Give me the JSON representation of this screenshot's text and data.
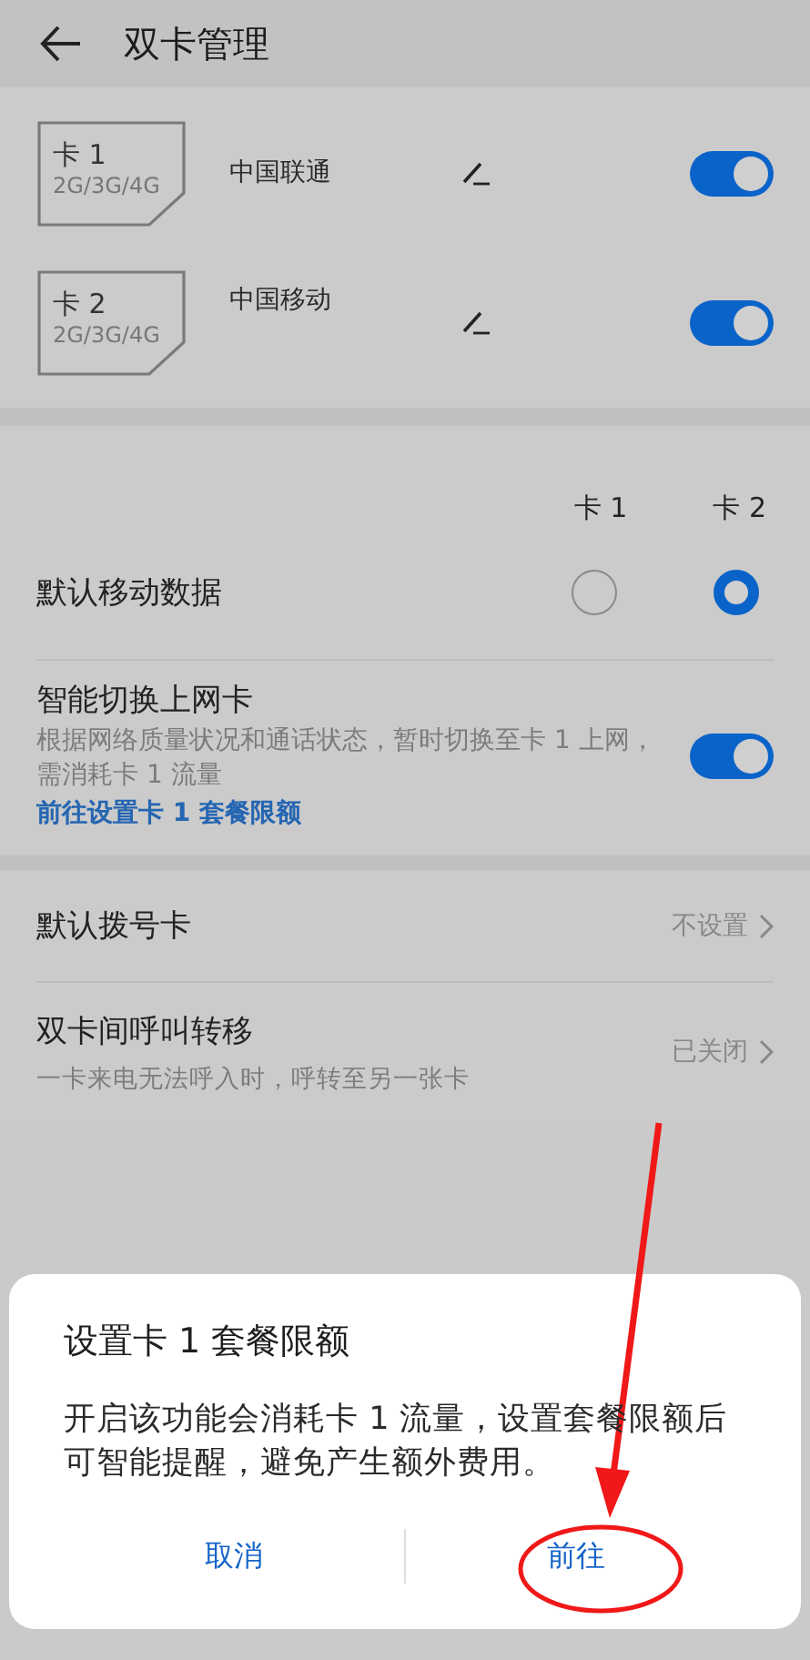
{
  "header": {
    "title": "双卡管理"
  },
  "sims": [
    {
      "label": "卡 1",
      "network": "2G/3G/4G",
      "carrier": "中国联通",
      "on": true
    },
    {
      "label": "卡 2",
      "network": "2G/3G/4G",
      "carrier": "中国移动",
      "on": true
    }
  ],
  "data_section": {
    "columns": [
      "卡 1",
      "卡 2"
    ],
    "default_data": {
      "label": "默认移动数据",
      "options": [
        {
          "selected": false
        },
        {
          "selected": true
        }
      ]
    },
    "smart_switch": {
      "title": "智能切换上网卡",
      "description": "根据网络质量状况和通话状态，暂时切换至卡 1 上网，需消耗卡 1 流量",
      "link": "前往设置卡 1 套餐限额",
      "on": true
    }
  },
  "call_settings": [
    {
      "title": "默认拨号卡",
      "value": "不设置"
    },
    {
      "title": "双卡间呼叫转移",
      "subtitle": "一卡来电无法呼入时，呼转至另一张卡",
      "value": "已关闭"
    }
  ],
  "dialog": {
    "title": "设置卡 1 套餐限额",
    "message": "开启该功能会消耗卡 1 流量，设置套餐限额后可智能提醒，避免产生额外费用。",
    "buttons": [
      "取消",
      "前往"
    ]
  }
}
